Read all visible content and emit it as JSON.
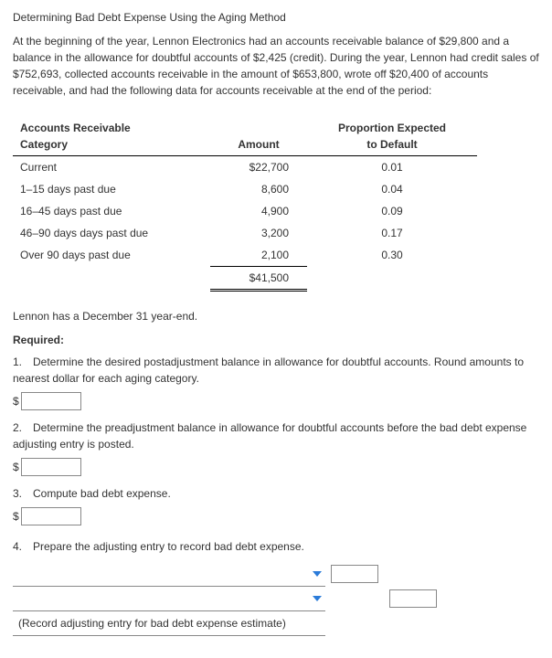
{
  "title": "Determining Bad Debt Expense Using the Aging Method",
  "intro": "At the beginning of the year, Lennon Electronics had an accounts receivable balance of $29,800 and a balance in the allowance for doubtful accounts of $2,425 (credit). During the year, Lennon had credit sales of $752,693, collected accounts receivable in the amount of $653,800, wrote off $20,400 of accounts receivable, and had the following data for accounts receivable at the end of the period:",
  "table": {
    "headers": {
      "cat1": "Accounts Receivable",
      "cat2": "Category",
      "amt": "Amount",
      "prop1": "Proportion Expected",
      "prop2": "to Default"
    },
    "rows": [
      {
        "cat": "Current",
        "amt": "$22,700",
        "prop": "0.01"
      },
      {
        "cat": "1–15 days past due",
        "amt": "8,600",
        "prop": "0.04"
      },
      {
        "cat": "16–45 days past due",
        "amt": "4,900",
        "prop": "0.09"
      },
      {
        "cat": "46–90 days days past due",
        "amt": "3,200",
        "prop": "0.17"
      },
      {
        "cat": "Over 90 days past due",
        "amt": "2,100",
        "prop": "0.30"
      }
    ],
    "total": "$41,500"
  },
  "yearend": "Lennon has a December 31 year-end.",
  "required_label": "Required:",
  "q1": "1. Determine the desired postadjustment balance in allowance for doubtful accounts. Round amounts to nearest dollar for each aging category.",
  "q2": "2. Determine the preadjustment balance in allowance for doubtful accounts before the bad debt expense adjusting entry is posted.",
  "q3": "3. Compute bad debt expense.",
  "q4": "4. Prepare the adjusting entry to record bad debt expense.",
  "je_desc": "(Record adjusting entry for bad debt expense estimate)",
  "dollar": "$"
}
